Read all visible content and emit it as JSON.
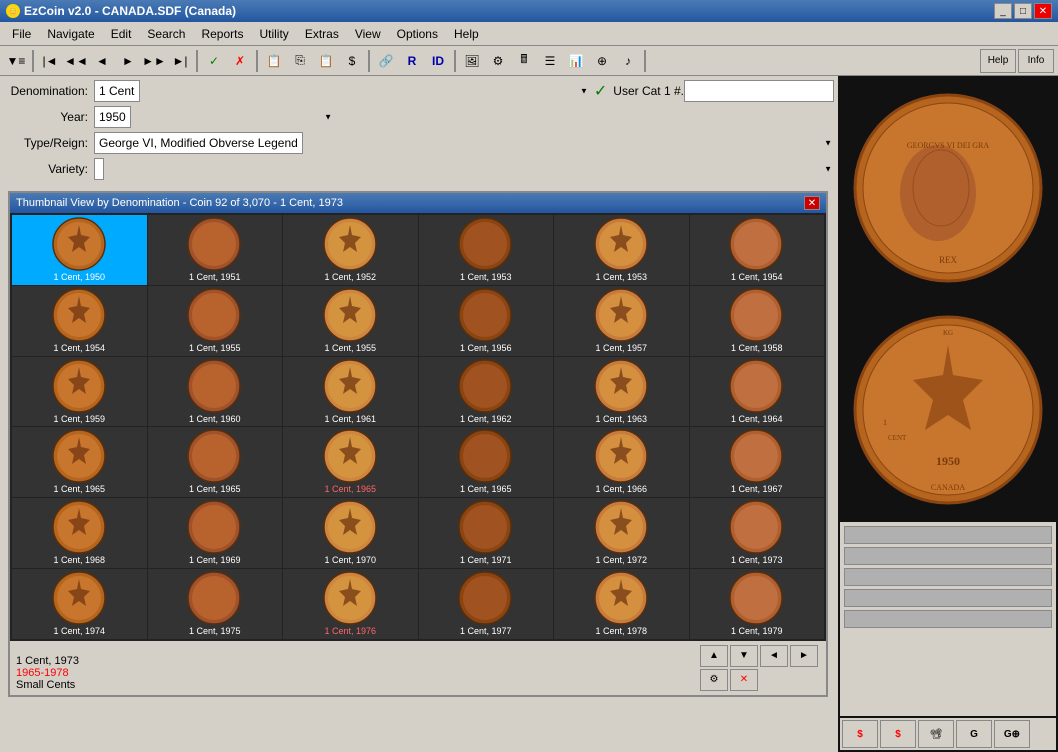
{
  "window": {
    "title": "EzCoin v2.0 - CANADA.SDF (Canada)",
    "title_icon": "coin"
  },
  "menu": {
    "items": [
      "File",
      "Navigate",
      "Edit",
      "Search",
      "Reports",
      "Utility",
      "Extras",
      "View",
      "Options",
      "Help"
    ]
  },
  "form": {
    "denomination_label": "Denomination:",
    "denomination_value": "1 Cent",
    "year_label": "Year:",
    "year_value": "1950",
    "type_label": "Type/Reign:",
    "type_value": "George VI, Modified Obverse Legend",
    "variety_label": "Variety:",
    "user_cat_label": "User Cat 1 #."
  },
  "thumbnail_window": {
    "title": "Thumbnail View by Denomination - Coin 92 of 3,070 - 1 Cent, 1973",
    "coins": [
      {
        "label": "1 Cent, 1950",
        "selected": true,
        "red": false,
        "row": 0
      },
      {
        "label": "1 Cent, 1951",
        "selected": false,
        "red": false,
        "row": 0
      },
      {
        "label": "1 Cent, 1952",
        "selected": false,
        "red": false,
        "row": 0
      },
      {
        "label": "1 Cent, 1953",
        "selected": false,
        "red": false,
        "row": 0
      },
      {
        "label": "1 Cent, 1953",
        "selected": false,
        "red": false,
        "row": 0
      },
      {
        "label": "1 Cent, 1954",
        "selected": false,
        "red": false,
        "row": 0
      },
      {
        "label": "1 Cent, 1954",
        "selected": false,
        "red": false,
        "row": 1
      },
      {
        "label": "1 Cent, 1955",
        "selected": false,
        "red": false,
        "row": 1
      },
      {
        "label": "1 Cent, 1955",
        "selected": false,
        "red": false,
        "row": 1
      },
      {
        "label": "1 Cent, 1956",
        "selected": false,
        "red": false,
        "row": 1
      },
      {
        "label": "1 Cent, 1957",
        "selected": false,
        "red": false,
        "row": 1
      },
      {
        "label": "1 Cent, 1958",
        "selected": false,
        "red": false,
        "row": 1
      },
      {
        "label": "1 Cent, 1959",
        "selected": false,
        "red": false,
        "row": 2
      },
      {
        "label": "1 Cent, 1960",
        "selected": false,
        "red": false,
        "row": 2
      },
      {
        "label": "1 Cent, 1961",
        "selected": false,
        "red": false,
        "row": 2
      },
      {
        "label": "1 Cent, 1962",
        "selected": false,
        "red": false,
        "row": 2
      },
      {
        "label": "1 Cent, 1963",
        "selected": false,
        "red": false,
        "row": 2
      },
      {
        "label": "1 Cent, 1964",
        "selected": false,
        "red": false,
        "row": 2
      },
      {
        "label": "1 Cent, 1965",
        "selected": false,
        "red": false,
        "row": 3
      },
      {
        "label": "1 Cent, 1965",
        "selected": false,
        "red": false,
        "row": 3
      },
      {
        "label": "1 Cent, 1965",
        "selected": false,
        "red": true,
        "row": 3
      },
      {
        "label": "1 Cent, 1965",
        "selected": false,
        "red": false,
        "row": 3
      },
      {
        "label": "1 Cent, 1966",
        "selected": false,
        "red": false,
        "row": 3
      },
      {
        "label": "1 Cent, 1967",
        "selected": false,
        "red": false,
        "row": 3
      },
      {
        "label": "1 Cent, 1968",
        "selected": false,
        "red": false,
        "row": 4
      },
      {
        "label": "1 Cent, 1969",
        "selected": false,
        "red": false,
        "row": 4
      },
      {
        "label": "1 Cent, 1970",
        "selected": false,
        "red": false,
        "row": 4
      },
      {
        "label": "1 Cent, 1971",
        "selected": false,
        "red": false,
        "row": 4
      },
      {
        "label": "1 Cent, 1972",
        "selected": false,
        "red": false,
        "row": 4
      },
      {
        "label": "1 Cent, 1973",
        "selected": false,
        "red": false,
        "row": 4
      },
      {
        "label": "1 Cent, 1974",
        "selected": false,
        "red": false,
        "row": 5
      },
      {
        "label": "1 Cent, 1975",
        "selected": false,
        "red": false,
        "row": 5
      },
      {
        "label": "1 Cent, 1976",
        "selected": false,
        "red": true,
        "row": 5
      },
      {
        "label": "1 Cent, 1977",
        "selected": false,
        "red": false,
        "row": 5
      },
      {
        "label": "1 Cent, 1978",
        "selected": false,
        "red": false,
        "row": 5
      },
      {
        "label": "1 Cent, 1979",
        "selected": false,
        "red": false,
        "row": 5
      }
    ],
    "footer_info_line1": "1 Cent, 1973",
    "footer_info_line2": "1965-1978",
    "footer_category": "Small Cents"
  },
  "nav_buttons": {
    "up": "▲",
    "down": "▼",
    "left": "◄",
    "right": "►",
    "tool": "⚙"
  },
  "right_panel": {
    "top_image_alt": "coin obverse large",
    "bottom_image_alt": "coin reverse large"
  },
  "toolbar_help": "Help",
  "toolbar_info": "Info"
}
